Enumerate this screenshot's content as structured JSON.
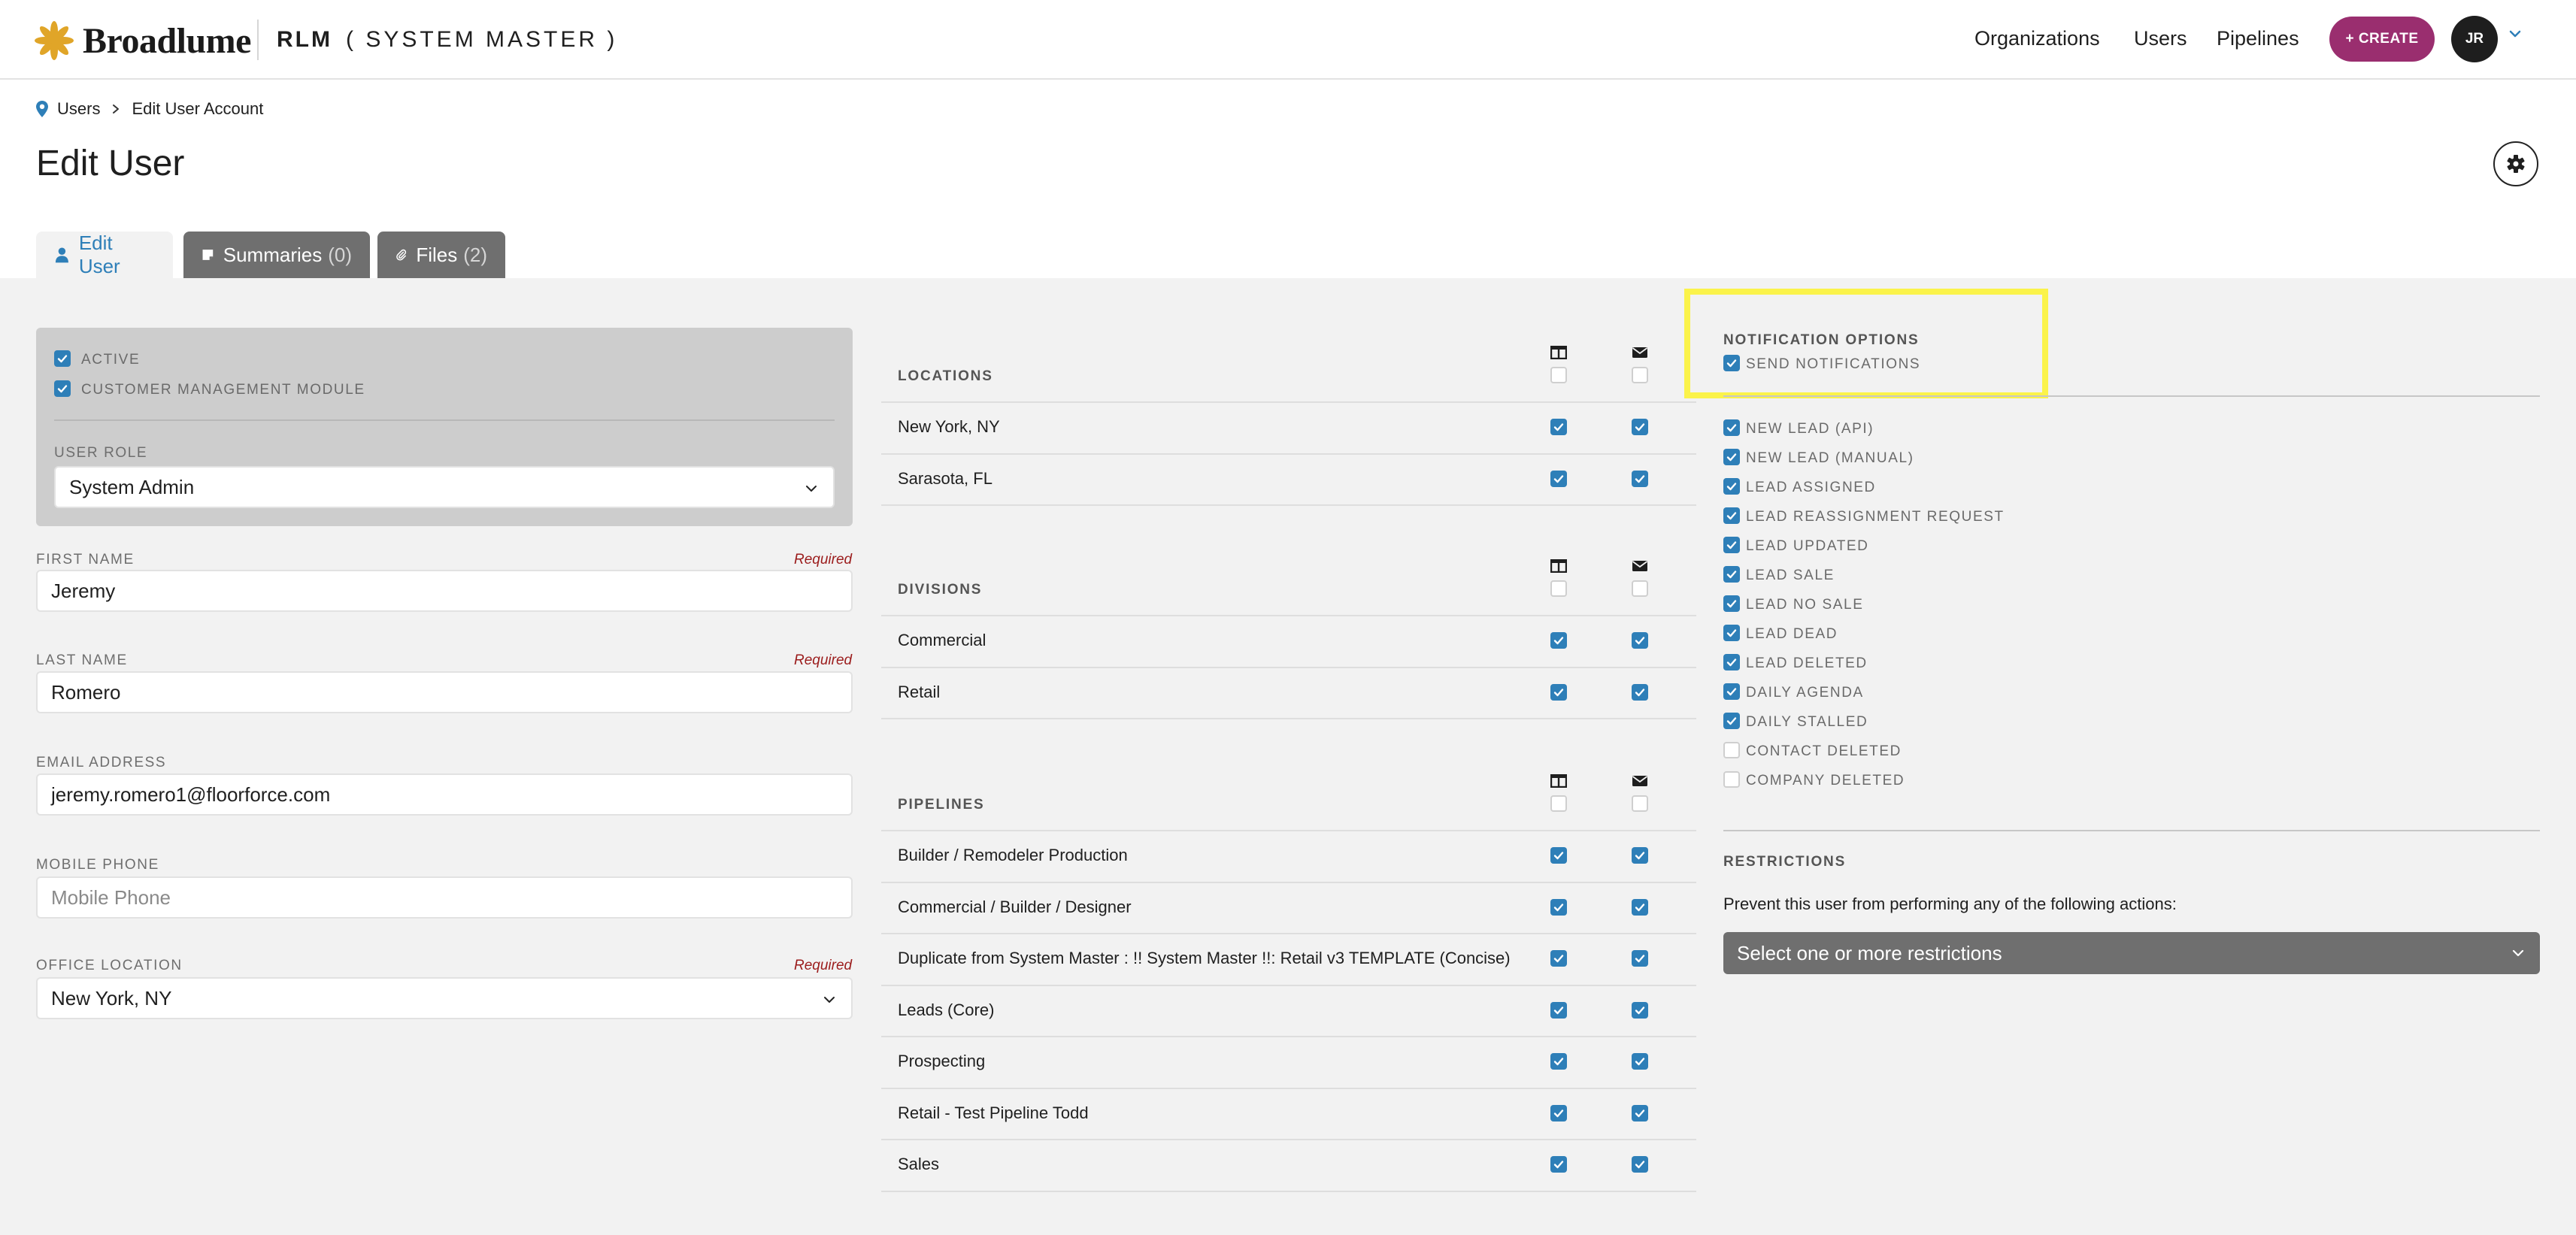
{
  "header": {
    "brand": "Broadlume",
    "app_name": "RLM",
    "app_context": "( SYSTEM MASTER )",
    "nav": [
      "Organizations",
      "Users",
      "Pipelines"
    ],
    "create_label": "+ CREATE",
    "avatar_initials": "JR"
  },
  "breadcrumb": {
    "parent": "Users",
    "current": "Edit User Account"
  },
  "page_title": "Edit User",
  "tabs": [
    {
      "label": "Edit User",
      "count": ""
    },
    {
      "label": "Summaries",
      "count": "(0)"
    },
    {
      "label": "Files",
      "count": "(2)"
    }
  ],
  "account": {
    "active_label": "ACTIVE",
    "active_checked": true,
    "cmm_label": "CUSTOMER MANAGEMENT MODULE",
    "cmm_checked": true,
    "role_label": "USER ROLE",
    "role_value": "System Admin"
  },
  "form": {
    "required_text": "Required",
    "first_name_label": "FIRST NAME",
    "first_name": "Jeremy",
    "last_name_label": "LAST NAME",
    "last_name": "Romero",
    "email_label": "EMAIL ADDRESS",
    "email": "jeremy.romero1@floorforce.com",
    "mobile_label": "MOBILE PHONE",
    "mobile_placeholder": "Mobile Phone",
    "office_label": "OFFICE LOCATION",
    "office_value": "New York, NY"
  },
  "locations": {
    "title": "LOCATIONS",
    "items": [
      {
        "name": "New York, NY",
        "view": true,
        "email": true
      },
      {
        "name": "Sarasota, FL",
        "view": true,
        "email": true
      }
    ]
  },
  "divisions": {
    "title": "DIVISIONS",
    "items": [
      {
        "name": "Commercial",
        "view": true,
        "email": true
      },
      {
        "name": "Retail",
        "view": true,
        "email": true
      }
    ]
  },
  "pipelines": {
    "title": "PIPELINES",
    "items": [
      {
        "name": "Builder / Remodeler Production",
        "view": true,
        "email": true
      },
      {
        "name": "Commercial / Builder / Designer",
        "view": true,
        "email": true
      },
      {
        "name": "Duplicate from System Master : !! System Master !!: Retail v3 TEMPLATE (Concise)",
        "view": true,
        "email": true
      },
      {
        "name": "Leads (Core)",
        "view": true,
        "email": true
      },
      {
        "name": "Prospecting",
        "view": true,
        "email": true
      },
      {
        "name": "Retail - Test Pipeline Todd",
        "view": true,
        "email": true
      },
      {
        "name": "Sales",
        "view": true,
        "email": true
      }
    ]
  },
  "notifications": {
    "title": "NOTIFICATION OPTIONS",
    "send_label": "SEND NOTIFICATIONS",
    "send_checked": true,
    "items": [
      {
        "label": "NEW LEAD (API)",
        "checked": true
      },
      {
        "label": "NEW LEAD (MANUAL)",
        "checked": true
      },
      {
        "label": "LEAD ASSIGNED",
        "checked": true
      },
      {
        "label": "LEAD REASSIGNMENT REQUEST",
        "checked": true
      },
      {
        "label": "LEAD UPDATED",
        "checked": true
      },
      {
        "label": "LEAD SALE",
        "checked": true
      },
      {
        "label": "LEAD NO SALE",
        "checked": true
      },
      {
        "label": "LEAD DEAD",
        "checked": true
      },
      {
        "label": "LEAD DELETED",
        "checked": true
      },
      {
        "label": "DAILY AGENDA",
        "checked": true
      },
      {
        "label": "DAILY STALLED",
        "checked": true
      },
      {
        "label": "CONTACT DELETED",
        "checked": false
      },
      {
        "label": "COMPANY DELETED",
        "checked": false
      }
    ]
  },
  "restrictions": {
    "title": "RESTRICTIONS",
    "description": "Prevent this user from performing any of the following actions:",
    "placeholder": "Select one or more restrictions"
  },
  "colors": {
    "accent": "#2e7fb8",
    "create": "#9a2e6f",
    "highlight": "#fbf34a",
    "required": "#9b1c1c"
  },
  "icons": {
    "breadcrumb": "map-pin-icon",
    "settings": "gear-icon",
    "tab_user": "user-icon",
    "tab_summaries": "note-icon",
    "tab_files": "paperclip-icon",
    "column_view": "columns-icon",
    "column_email": "envelope-icon"
  }
}
